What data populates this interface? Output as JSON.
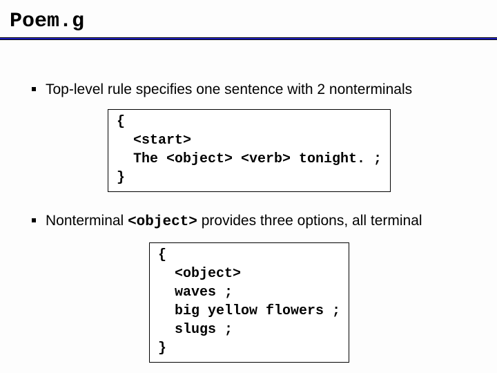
{
  "title": "Poem.g",
  "bullets": [
    {
      "text": "Top-level rule specifies one sentence with 2 nonterminals"
    },
    {
      "prefix": "Nonterminal ",
      "code": "<object>",
      "suffix": " provides three options, all terminal"
    }
  ],
  "code_blocks": [
    "{\n  <start>\n  The <object> <verb> tonight. ;\n}",
    "{\n  <object>\n  waves ;\n  big yellow flowers ;\n  slugs ;\n}"
  ]
}
